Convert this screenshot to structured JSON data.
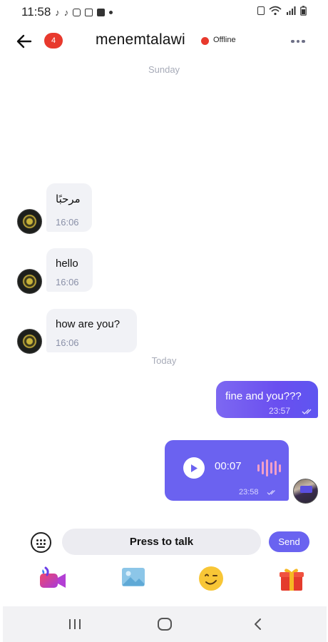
{
  "status_bar": {
    "time": "11:58"
  },
  "header": {
    "back_icon": "arrow-left-icon",
    "unread_count": "4",
    "contact_name": "menemtalawi",
    "presence": "Offline",
    "more_icon": "more-horizontal-icon"
  },
  "separators": {
    "first": "Sunday",
    "second": "Today"
  },
  "messages": [
    {
      "text": "مرحبًا",
      "time": "16:06"
    },
    {
      "text": "hello",
      "time": "16:06"
    },
    {
      "text": "how are you?",
      "time": "16:06"
    }
  ],
  "outgoing": {
    "text": "fine and you???",
    "time": "23:57"
  },
  "voice": {
    "duration": "00:07",
    "time": "23:58"
  },
  "composer": {
    "talk_label": "Press to talk",
    "send_label": "Send"
  },
  "actions": [
    "video-call-icon",
    "image-icon",
    "emoji-icon",
    "gift-icon"
  ],
  "colors": {
    "accent": "#6a63f0",
    "badge": "#e8392d",
    "incoming_bubble": "#f1f2f6"
  }
}
